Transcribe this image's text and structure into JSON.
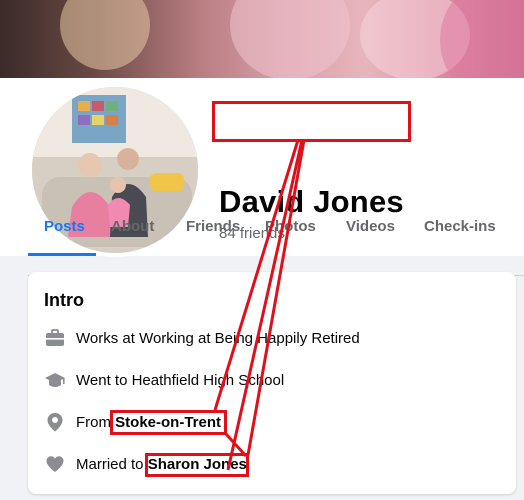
{
  "profile": {
    "name": "David Jones",
    "friends": "84 friends"
  },
  "tabs": [
    "Posts",
    "About",
    "Friends",
    "Photos",
    "Videos",
    "Check-ins"
  ],
  "intro": {
    "title": "Intro",
    "work": "Works at Working at Being Happily Retired",
    "education": "Went to Heathfield High School",
    "from_prefix": "From ",
    "from_place": "Stoke-on-Trent",
    "married_prefix": "Married to ",
    "married_name": "Sharon Jones"
  },
  "colors": {
    "accent": "#1877f2",
    "annotation": "#e0101b",
    "icon": "#8a8d91"
  },
  "icons": {
    "work": "briefcase-icon",
    "education": "graduation-cap-icon",
    "from": "location-pin-icon",
    "married": "heart-icon"
  }
}
